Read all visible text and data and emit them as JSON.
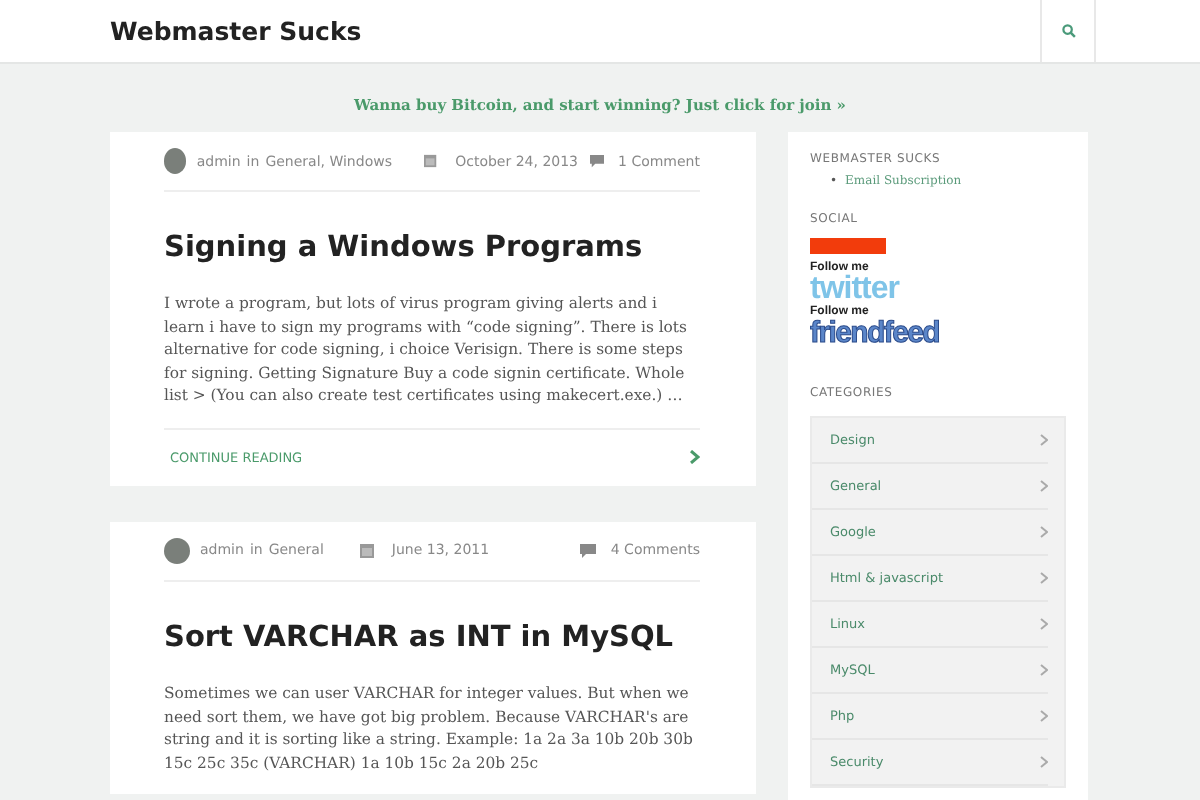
{
  "header": {
    "site_title": "Webmaster Sucks"
  },
  "banner": {
    "text": "Wanna buy Bitcoin, and start winning? Just click for join »"
  },
  "posts": [
    {
      "author": "admin",
      "in": "in",
      "categories": "General, Windows",
      "date": "October 24, 2013",
      "comments": "1 Comment",
      "title": "Signing a Windows Programs",
      "excerpt": "I wrote a program, but lots of virus program giving alerts and i learn i have to sign my programs with “code signing”. There is lots alternative for code signing, i choice Verisign. There is some steps for signing. Getting Signature Buy a code signin certificate. Whole list > (You can also create test certificates using makecert.exe.) …",
      "more": "CONTINUE READING"
    },
    {
      "author": "admin",
      "in": "in",
      "categories": "General",
      "date": "June 13, 2011",
      "comments": "4 Comments",
      "title": "Sort VARCHAR as INT in MySQL",
      "excerpt": "Sometimes we can user VARCHAR for integer values. But when we need sort them, we have got big problem. Because VARCHAR's are string and it is sorting like a string. Example: 1a 2a 3a 10b 20b 30b 15c 25c 35c (VARCHAR) 1a 10b 15c 2a 20b 25c"
    }
  ],
  "sidebar": {
    "widget_title": "WEBMASTER SUCKS",
    "links": [
      {
        "bullet": "•",
        "text": "Email Subscription"
      }
    ],
    "social_title": "SOCIAL",
    "social_badges": [
      {
        "caption": "Follow me",
        "logo": "twitter"
      },
      {
        "caption": "Follow me",
        "logo": "friendfeed"
      }
    ],
    "categories_title": "CATEGORIES",
    "categories": [
      "Design",
      "General",
      "Google",
      "Html & javascript",
      "Linux",
      "MySQL",
      "Php",
      "Security"
    ]
  }
}
